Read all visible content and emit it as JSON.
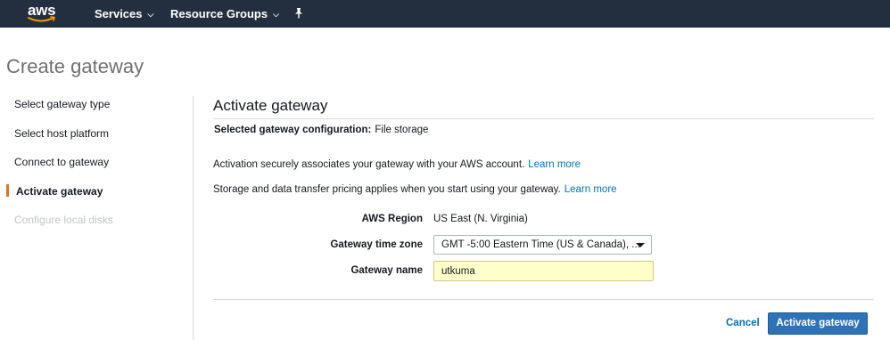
{
  "topbar": {
    "logo_text": "aws",
    "services_label": "Services",
    "resource_groups_label": "Resource Groups"
  },
  "page": {
    "title": "Create gateway"
  },
  "sidebar": {
    "items": [
      {
        "label": "Select gateway type",
        "state": "normal"
      },
      {
        "label": "Select host platform",
        "state": "normal"
      },
      {
        "label": "Connect to gateway",
        "state": "normal"
      },
      {
        "label": "Activate gateway",
        "state": "active"
      },
      {
        "label": "Configure local disks",
        "state": "disabled"
      }
    ]
  },
  "main": {
    "section_title": "Activate gateway",
    "config_label": "Selected gateway configuration:",
    "config_value": "File storage",
    "info1_text": "Activation securely associates your gateway with your AWS account.",
    "info1_link": "Learn more",
    "info2_text": "Storage and data transfer pricing applies when you start using your gateway.",
    "info2_link": "Learn more",
    "form": {
      "region_label": "AWS Region",
      "region_value": "US East (N. Virginia)",
      "timezone_label": "Gateway time zone",
      "timezone_value": "GMT -5:00 Eastern Time (US & Canada), ...",
      "name_label": "Gateway name",
      "name_value": "utkuma"
    },
    "actions": {
      "cancel_label": "Cancel",
      "activate_label": "Activate gateway"
    }
  },
  "colors": {
    "topbar_bg": "#232f3e",
    "accent_orange": "#ec7211",
    "link_blue": "#0073bb",
    "primary_button": "#2e73b8",
    "input_autofill_bg": "#ffffcc"
  }
}
